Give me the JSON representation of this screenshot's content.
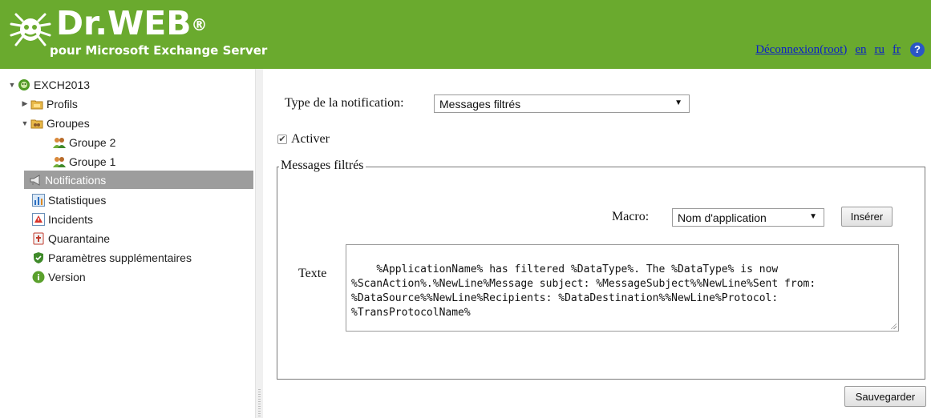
{
  "header": {
    "brand": "Dr.WEB",
    "registered": "®",
    "subtitle": "pour Microsoft Exchange Server",
    "links": {
      "logout": "Déconnexion(root)",
      "lang_en": "en",
      "lang_ru": "ru",
      "lang_fr": "fr",
      "help": "?"
    },
    "colors": {
      "bar": "#6aaa2e",
      "link": "#0a1fc9"
    }
  },
  "sidebar": {
    "root": {
      "label": "EXCH2013",
      "icon": "spider-icon"
    },
    "items": [
      {
        "label": "Profils",
        "icon": "folder-icon"
      },
      {
        "label": "Groupes",
        "icon": "group-folder-icon"
      },
      {
        "label": "Groupe 2",
        "icon": "users-icon"
      },
      {
        "label": "Groupe 1",
        "icon": "users-icon"
      },
      {
        "label": "Notifications",
        "icon": "megaphone-icon",
        "selected": true
      },
      {
        "label": "Statistiques",
        "icon": "chart-icon"
      },
      {
        "label": "Incidents",
        "icon": "incident-icon"
      },
      {
        "label": "Quarantaine",
        "icon": "quarantine-icon"
      },
      {
        "label": "Paramètres supplémentaires",
        "icon": "shield-icon"
      },
      {
        "label": "Version",
        "icon": "info-icon"
      }
    ]
  },
  "main": {
    "type_label": "Type de la notification:",
    "type_value": "Messages filtrés",
    "activate_label": "Activer",
    "activate_checked": true,
    "fieldset_legend": "Messages filtrés",
    "macro_label": "Macro:",
    "macro_value": "Nom d'application",
    "insert_button": "Insérer",
    "text_label": "Texte",
    "text_value": "%ApplicationName% has filtered %DataType%. The %DataType% is now %ScanAction%.%NewLine%Message subject: %MessageSubject%%NewLine%Sent from: %DataSource%%NewLine%Recipients: %DataDestination%%NewLine%Protocol: %TransProtocolName%",
    "save_button": "Sauvegarder"
  }
}
